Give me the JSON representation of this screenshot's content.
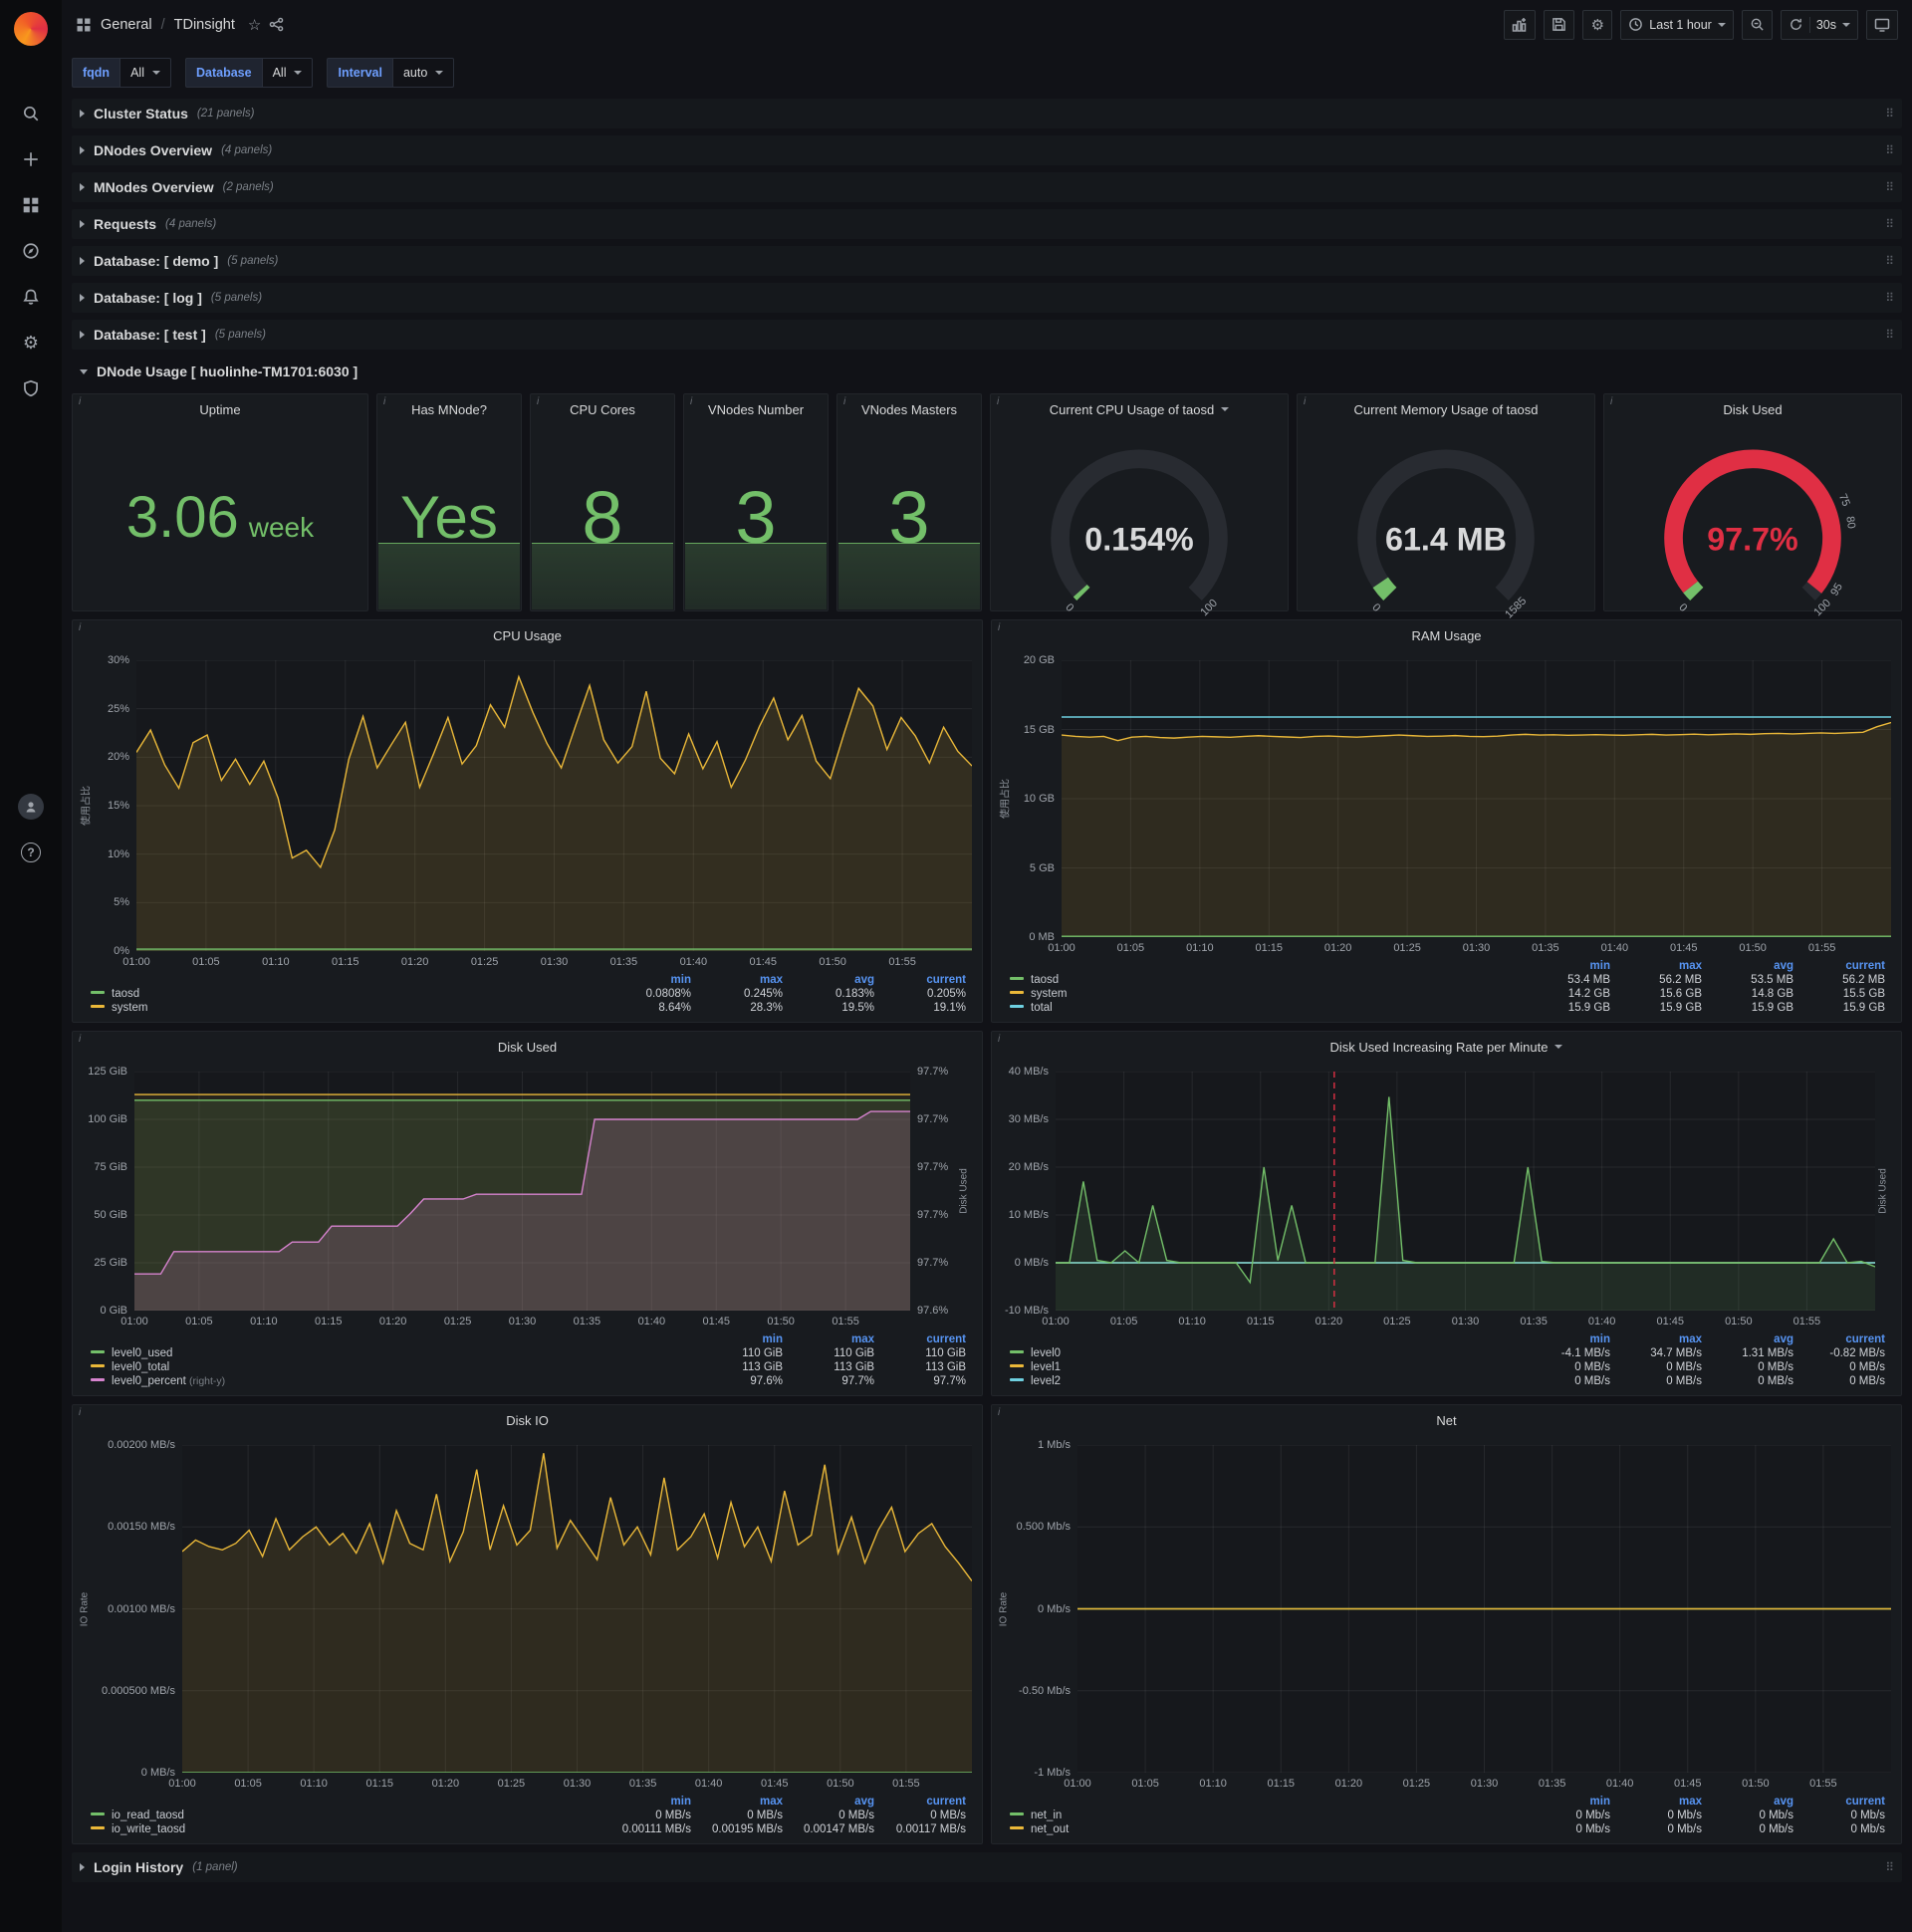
{
  "topnav": {
    "breadcrumb": {
      "section": "General",
      "separator": "/",
      "title": "TDinsight"
    },
    "time_picker": {
      "label": "Last 1 hour"
    },
    "refresh": {
      "interval": "30s"
    }
  },
  "variables": [
    {
      "label": "fqdn",
      "value": "All"
    },
    {
      "label": "Database",
      "value": "All"
    },
    {
      "label": "Interval",
      "value": "auto"
    }
  ],
  "rows_top": [
    {
      "title": "Cluster Status",
      "count": "(21 panels)"
    },
    {
      "title": "DNodes Overview",
      "count": "(4 panels)"
    },
    {
      "title": "MNodes Overview",
      "count": "(2 panels)"
    },
    {
      "title": "Requests",
      "count": "(4 panels)"
    },
    {
      "title": "Database: [ demo ]",
      "count": "(5 panels)"
    },
    {
      "title": "Database: [ log ]",
      "count": "(5 panels)"
    },
    {
      "title": "Database: [ test ]",
      "count": "(5 panels)"
    }
  ],
  "dnode_row": {
    "title": "DNode Usage [ huolinhe-TM1701:6030 ]"
  },
  "rows_bottom": [
    {
      "title": "Login History",
      "count": "(1 panel)"
    }
  ],
  "stats": [
    {
      "title": "Uptime",
      "value": "3.06",
      "unit": "week"
    },
    {
      "title": "Has MNode?",
      "value": "Yes"
    },
    {
      "title": "CPU Cores",
      "value": "8"
    },
    {
      "title": "VNodes Number",
      "value": "3"
    },
    {
      "title": "VNodes Masters",
      "value": "3"
    }
  ],
  "gauges": [
    {
      "key": "cpu",
      "title": "Current CPU Usage of taosd",
      "value": "0.154%",
      "value_color": "#d8d9da",
      "min_label": "0",
      "max_label": "100",
      "segments": [
        {
          "from": 0,
          "to": 0.012,
          "color": "#73bf69"
        }
      ],
      "labels": []
    },
    {
      "key": "mem",
      "title": "Current Memory Usage of taosd",
      "value": "61.4 MB",
      "value_color": "#d8d9da",
      "min_label": "0",
      "max_label": "1585",
      "segments": [
        {
          "from": 0,
          "to": 0.04,
          "color": "#73bf69"
        }
      ],
      "labels": []
    },
    {
      "key": "disk",
      "title": "Disk Used",
      "value": "97.7%",
      "value_color": "#e02f44",
      "min_label": "0",
      "max_label": "",
      "segments": [
        {
          "from": 0,
          "to": 0.025,
          "color": "#73bf69"
        },
        {
          "from": 0.025,
          "to": 0.977,
          "color": "#e02f44"
        }
      ],
      "labels": [
        {
          "text": "75",
          "frac": 0.75
        },
        {
          "text": "80",
          "frac": 0.8
        },
        {
          "text": "95",
          "frac": 0.95
        },
        {
          "text": "100",
          "frac": 1.0
        }
      ]
    }
  ],
  "charts": {
    "x_ticks": [
      "01:00",
      "01:05",
      "01:10",
      "01:15",
      "01:20",
      "01:25",
      "01:30",
      "01:35",
      "01:40",
      "01:45",
      "01:50",
      "01:55"
    ],
    "panels": {
      "cpu": {
        "title": "CPU Usage",
        "ylabel_left": "使用占比",
        "y_ticks": [
          "30%",
          "25%",
          "20%",
          "15%",
          "10%",
          "5%",
          "0%"
        ],
        "yrange": [
          0,
          30
        ],
        "series": [
          {
            "name": "system",
            "color": "#eab839",
            "fill": "rgba(234,184,57,0.14)",
            "data": [
              20.5,
              22.8,
              19.2,
              16.8,
              21.5,
              22.3,
              17.6,
              19.8,
              17.2,
              19.6,
              15.8,
              9.6,
              10.4,
              8.64,
              12.5,
              19.8,
              24.2,
              18.9,
              21.3,
              23.6,
              16.9,
              20.4,
              24.1,
              19.3,
              21.2,
              25.4,
              23.1,
              28.3,
              24.6,
              21.4,
              18.9,
              23.2,
              27.4,
              21.8,
              19.4,
              21.1,
              26.8,
              19.9,
              18.3,
              22.4,
              18.8,
              21.6,
              16.9,
              19.7,
              23.2,
              26.1,
              21.8,
              24.3,
              19.6,
              17.8,
              22.6,
              27.1,
              25.3,
              20.8,
              24.1,
              22.2,
              19.4,
              23.1,
              20.6,
              19.1
            ]
          },
          {
            "name": "taosd",
            "color": "#73bf69",
            "fill": "rgba(115,191,105,0.15)",
            "data": [
              0.2,
              0.2
            ]
          }
        ],
        "legend": {
          "columns": [
            "min",
            "max",
            "avg",
            "current"
          ],
          "rows": [
            {
              "name": "taosd",
              "color": "#73bf69",
              "values": [
                "0.0808%",
                "0.245%",
                "0.183%",
                "0.205%"
              ]
            },
            {
              "name": "system",
              "color": "#eab839",
              "values": [
                "8.64%",
                "28.3%",
                "19.5%",
                "19.1%"
              ]
            }
          ]
        }
      },
      "ram": {
        "title": "RAM Usage",
        "ylabel_left": "使用占比",
        "y_ticks": [
          "20 GB",
          "15 GB",
          "10 GB",
          "5 GB",
          "0 MB"
        ],
        "yrange": [
          0,
          20
        ],
        "series": [
          {
            "name": "system",
            "color": "#eab839",
            "fill": "rgba(234,184,57,0.12)",
            "data": [
              14.6,
              14.5,
              14.45,
              14.5,
              14.2,
              14.45,
              14.5,
              14.42,
              14.38,
              14.45,
              14.5,
              14.47,
              14.44,
              14.5,
              14.55,
              14.5,
              14.46,
              14.42,
              14.5,
              14.53,
              14.48,
              14.45,
              14.5,
              14.55,
              14.6,
              14.55,
              14.5,
              14.52,
              14.56,
              14.5,
              14.48,
              14.52,
              14.6,
              14.65,
              14.6,
              14.62,
              14.58,
              14.6,
              14.63,
              14.6,
              14.58,
              14.62,
              14.65,
              14.6,
              14.63,
              14.66,
              14.62,
              14.65,
              14.68,
              14.65,
              14.7,
              14.72,
              14.68,
              14.72,
              14.75,
              14.72,
              14.76,
              14.8,
              15.2,
              15.5
            ]
          },
          {
            "name": "total",
            "color": "#6ed0e0",
            "fill": null,
            "data": [
              15.9,
              15.9
            ]
          },
          {
            "name": "taosd",
            "color": "#73bf69",
            "fill": "rgba(115,191,105,0.15)",
            "data": [
              0.055,
              0.055
            ]
          }
        ],
        "legend": {
          "columns": [
            "min",
            "max",
            "avg",
            "current"
          ],
          "rows": [
            {
              "name": "taosd",
              "color": "#73bf69",
              "values": [
                "53.4 MB",
                "56.2 MB",
                "53.5 MB",
                "56.2 MB"
              ]
            },
            {
              "name": "system",
              "color": "#eab839",
              "values": [
                "14.2 GB",
                "15.6 GB",
                "14.8 GB",
                "15.5 GB"
              ]
            },
            {
              "name": "total",
              "color": "#6ed0e0",
              "values": [
                "15.9 GB",
                "15.9 GB",
                "15.9 GB",
                "15.9 GB"
              ]
            }
          ]
        }
      },
      "disk_used": {
        "title": "Disk Used",
        "ylabel_right": "Disk Used",
        "y_ticks": [
          "125 GiB",
          "100 GiB",
          "75 GiB",
          "50 GiB",
          "25 GiB",
          "0 GiB"
        ],
        "y_ticks_right": [
          "97.7%",
          "97.7%",
          "97.7%",
          "97.7%",
          "97.7%",
          "97.6%"
        ],
        "yrange": [
          0,
          125
        ],
        "series": [
          {
            "name": "level0_total",
            "color": "#eab839",
            "fill": "rgba(234,184,57,0.08)",
            "data": [
              113,
              113
            ]
          },
          {
            "name": "level0_used",
            "color": "#73bf69",
            "fill": "rgba(115,191,105,0.12)",
            "data": [
              110,
              110
            ]
          },
          {
            "name": "level0_percent",
            "color": "#d683ce",
            "fill": "rgba(214,131,206,0.18)",
            "range": [
              97.575,
              97.725
            ],
            "data": [
              97.598,
              97.598,
              97.598,
              97.612,
              97.612,
              97.612,
              97.612,
              97.612,
              97.612,
              97.612,
              97.612,
              97.612,
              97.618,
              97.618,
              97.618,
              97.628,
              97.628,
              97.628,
              97.628,
              97.628,
              97.628,
              97.636,
              97.645,
              97.645,
              97.645,
              97.645,
              97.648,
              97.648,
              97.648,
              97.648,
              97.648,
              97.648,
              97.648,
              97.648,
              97.648,
              97.695,
              97.695,
              97.695,
              97.695,
              97.695,
              97.695,
              97.695,
              97.695,
              97.695,
              97.695,
              97.695,
              97.695,
              97.695,
              97.695,
              97.695,
              97.695,
              97.695,
              97.695,
              97.695,
              97.695,
              97.695,
              97.7,
              97.7,
              97.7,
              97.7
            ]
          }
        ],
        "legend": {
          "columns": [
            "min",
            "max",
            "current"
          ],
          "rows": [
            {
              "name": "level0_used",
              "color": "#73bf69",
              "values": [
                "110 GiB",
                "110 GiB",
                "110 GiB"
              ]
            },
            {
              "name": "level0_total",
              "color": "#eab839",
              "values": [
                "113 GiB",
                "113 GiB",
                "113 GiB"
              ]
            },
            {
              "name": "level0_percent",
              "suffix": "(right-y)",
              "color": "#d683ce",
              "values": [
                "97.6%",
                "97.7%",
                "97.7%"
              ]
            }
          ]
        }
      },
      "disk_rate": {
        "title": "Disk Used Increasing Rate per Minute",
        "ylabel_right": "Disk Used",
        "y_ticks": [
          "40 MB/s",
          "30 MB/s",
          "20 MB/s",
          "10 MB/s",
          "0 MB/s",
          "-10 MB/s"
        ],
        "yrange": [
          -10,
          40
        ],
        "annotation_x": 0.34,
        "annotation_color": "#e02f44",
        "series": [
          {
            "name": "level1",
            "color": "#eab839",
            "fill": null,
            "data": [
              0,
              0
            ]
          },
          {
            "name": "level2",
            "color": "#6ed0e0",
            "fill": null,
            "data": [
              0,
              0
            ]
          },
          {
            "name": "level0",
            "color": "#73bf69",
            "fill": "rgba(115,191,105,0.12)",
            "data": [
              0,
              0,
              17,
              0.5,
              0,
              2.5,
              0,
              12,
              0.5,
              0,
              0,
              0,
              0,
              0,
              -4.1,
              20,
              0.5,
              12,
              0,
              0,
              0,
              0,
              0,
              0,
              34.7,
              0.5,
              0,
              0,
              0,
              0,
              0,
              0,
              0,
              0,
              20,
              0.3,
              0,
              0,
              0,
              0,
              0,
              0,
              0,
              0,
              0,
              0,
              0,
              0,
              0,
              0,
              0,
              0,
              0,
              0,
              0,
              0,
              5,
              0,
              0.3,
              -0.82
            ]
          }
        ],
        "legend": {
          "columns": [
            "min",
            "max",
            "avg",
            "current"
          ],
          "rows": [
            {
              "name": "level0",
              "color": "#73bf69",
              "values": [
                "-4.1 MB/s",
                "34.7 MB/s",
                "1.31 MB/s",
                "-0.82 MB/s"
              ]
            },
            {
              "name": "level1",
              "color": "#eab839",
              "values": [
                "0 MB/s",
                "0 MB/s",
                "0 MB/s",
                "0 MB/s"
              ]
            },
            {
              "name": "level2",
              "color": "#6ed0e0",
              "values": [
                "0 MB/s",
                "0 MB/s",
                "0 MB/s",
                "0 MB/s"
              ]
            }
          ]
        }
      },
      "disk_io": {
        "title": "Disk IO",
        "ylabel_left": "IO Rate",
        "y_ticks": [
          "0.00200 MB/s",
          "0.00150 MB/s",
          "0.00100 MB/s",
          "0.000500 MB/s",
          "0 MB/s"
        ],
        "yrange": [
          0,
          0.002
        ],
        "series": [
          {
            "name": "io_write_taosd",
            "color": "#eab839",
            "fill": "rgba(234,184,57,0.12)",
            "data": [
              0.00135,
              0.00142,
              0.00138,
              0.00136,
              0.0014,
              0.00148,
              0.00132,
              0.00155,
              0.00136,
              0.00144,
              0.0015,
              0.00139,
              0.00146,
              0.00134,
              0.00152,
              0.00128,
              0.0016,
              0.0014,
              0.00136,
              0.0017,
              0.00129,
              0.00147,
              0.00185,
              0.00136,
              0.00163,
              0.00139,
              0.00148,
              0.00195,
              0.00137,
              0.00154,
              0.00142,
              0.0013,
              0.00168,
              0.00139,
              0.0015,
              0.00133,
              0.0018,
              0.00136,
              0.00144,
              0.00158,
              0.00131,
              0.00165,
              0.00138,
              0.0015,
              0.00129,
              0.00172,
              0.00139,
              0.00145,
              0.00188,
              0.00134,
              0.00156,
              0.00128,
              0.00148,
              0.00162,
              0.00135,
              0.00146,
              0.00152,
              0.00138,
              0.00128,
              0.00117
            ]
          },
          {
            "name": "io_read_taosd",
            "color": "#73bf69",
            "fill": null,
            "data": [
              0,
              0
            ]
          }
        ],
        "legend": {
          "columns": [
            "min",
            "max",
            "avg",
            "current"
          ],
          "rows": [
            {
              "name": "io_read_taosd",
              "color": "#73bf69",
              "values": [
                "0 MB/s",
                "0 MB/s",
                "0 MB/s",
                "0 MB/s"
              ]
            },
            {
              "name": "io_write_taosd",
              "color": "#eab839",
              "values": [
                "0.00111 MB/s",
                "0.00195 MB/s",
                "0.00147 MB/s",
                "0.00117 MB/s"
              ]
            }
          ]
        }
      },
      "net": {
        "title": "Net",
        "ylabel_left": "IO Rate",
        "y_ticks": [
          "1 Mb/s",
          "0.500 Mb/s",
          "0 Mb/s",
          "-0.50 Mb/s",
          "-1 Mb/s"
        ],
        "yrange": [
          -1,
          1
        ],
        "series": [
          {
            "name": "net_in",
            "color": "#73bf69",
            "fill": null,
            "data": [
              0,
              0
            ]
          },
          {
            "name": "net_out",
            "color": "#eab839",
            "fill": null,
            "data": [
              0,
              0
            ]
          }
        ],
        "legend": {
          "columns": [
            "min",
            "max",
            "avg",
            "current"
          ],
          "rows": [
            {
              "name": "net_in",
              "color": "#73bf69",
              "values": [
                "0 Mb/s",
                "0 Mb/s",
                "0 Mb/s",
                "0 Mb/s"
              ]
            },
            {
              "name": "net_out",
              "color": "#eab839",
              "values": [
                "0 Mb/s",
                "0 Mb/s",
                "0 Mb/s",
                "0 Mb/s"
              ]
            }
          ]
        }
      }
    }
  }
}
